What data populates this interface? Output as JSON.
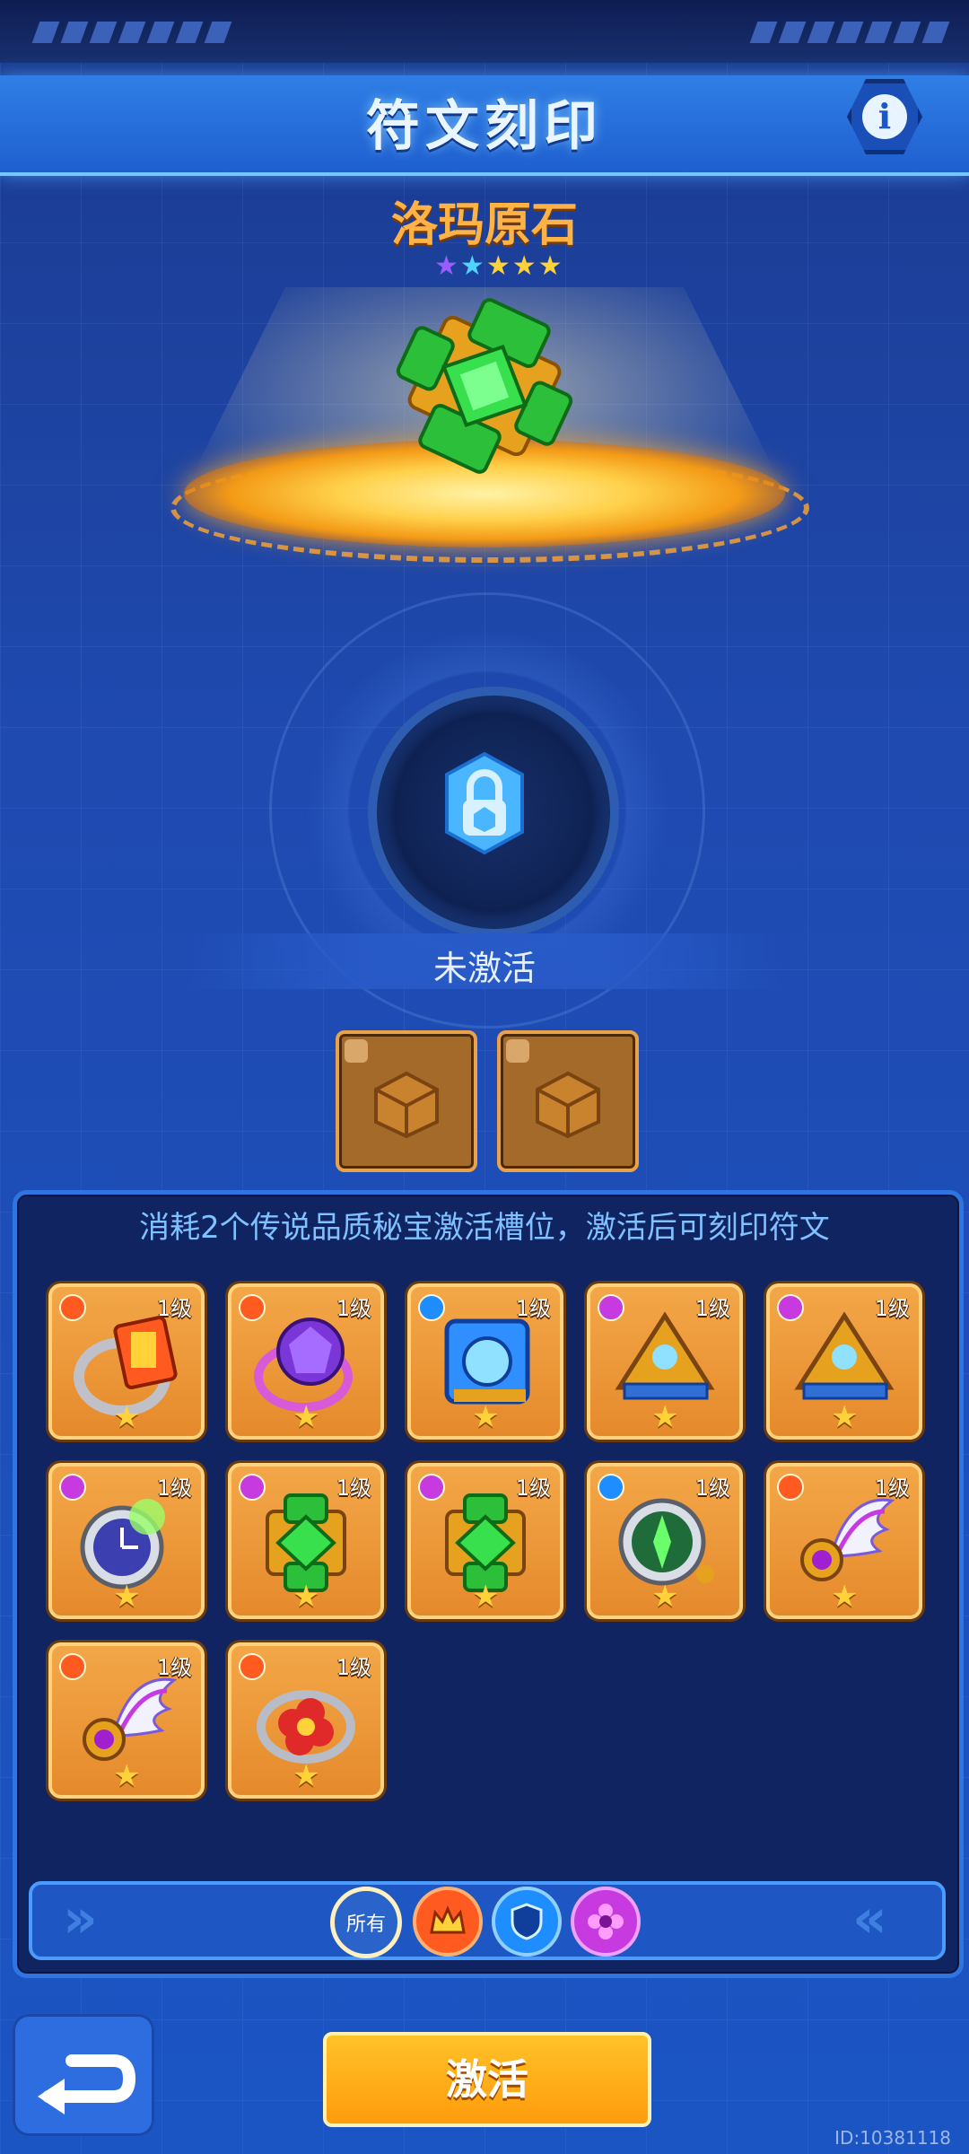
{
  "header": {
    "title": "符文刻印",
    "info_label": "i"
  },
  "item": {
    "name": "洛玛原石",
    "stars": 5
  },
  "status": {
    "text": "未激活"
  },
  "panel": {
    "hint": "消耗2个传说品质秘宝激活槽位，激活后可刻印符文",
    "cards": [
      {
        "level": "1级",
        "type": "legend",
        "icon": "orange-card-ring-icon"
      },
      {
        "level": "1级",
        "type": "legend",
        "icon": "purple-gem-ring-icon"
      },
      {
        "level": "1级",
        "type": "rare",
        "icon": "blue-cube-icon"
      },
      {
        "level": "1级",
        "type": "epic",
        "icon": "gold-pyramid-icon"
      },
      {
        "level": "1级",
        "type": "epic",
        "icon": "gold-pyramid-icon"
      },
      {
        "level": "1级",
        "type": "epic",
        "icon": "pocket-watch-icon"
      },
      {
        "level": "1级",
        "type": "epic",
        "icon": "green-gem-icon"
      },
      {
        "level": "1级",
        "type": "epic",
        "icon": "green-gem-icon"
      },
      {
        "level": "1级",
        "type": "rare",
        "icon": "green-compass-icon"
      },
      {
        "level": "1级",
        "type": "legend",
        "icon": "winged-orb-icon"
      },
      {
        "level": "1级",
        "type": "legend",
        "icon": "winged-orb-icon"
      },
      {
        "level": "1级",
        "type": "legend",
        "icon": "red-flower-ring-icon"
      }
    ]
  },
  "filters": {
    "all_label": "所有"
  },
  "buttons": {
    "activate": "激活"
  },
  "footer": {
    "id_text": "ID:10381118"
  },
  "colors": {
    "legend": "#ff5a1f",
    "rare": "#1e8dff",
    "epic": "#c63ae0"
  }
}
